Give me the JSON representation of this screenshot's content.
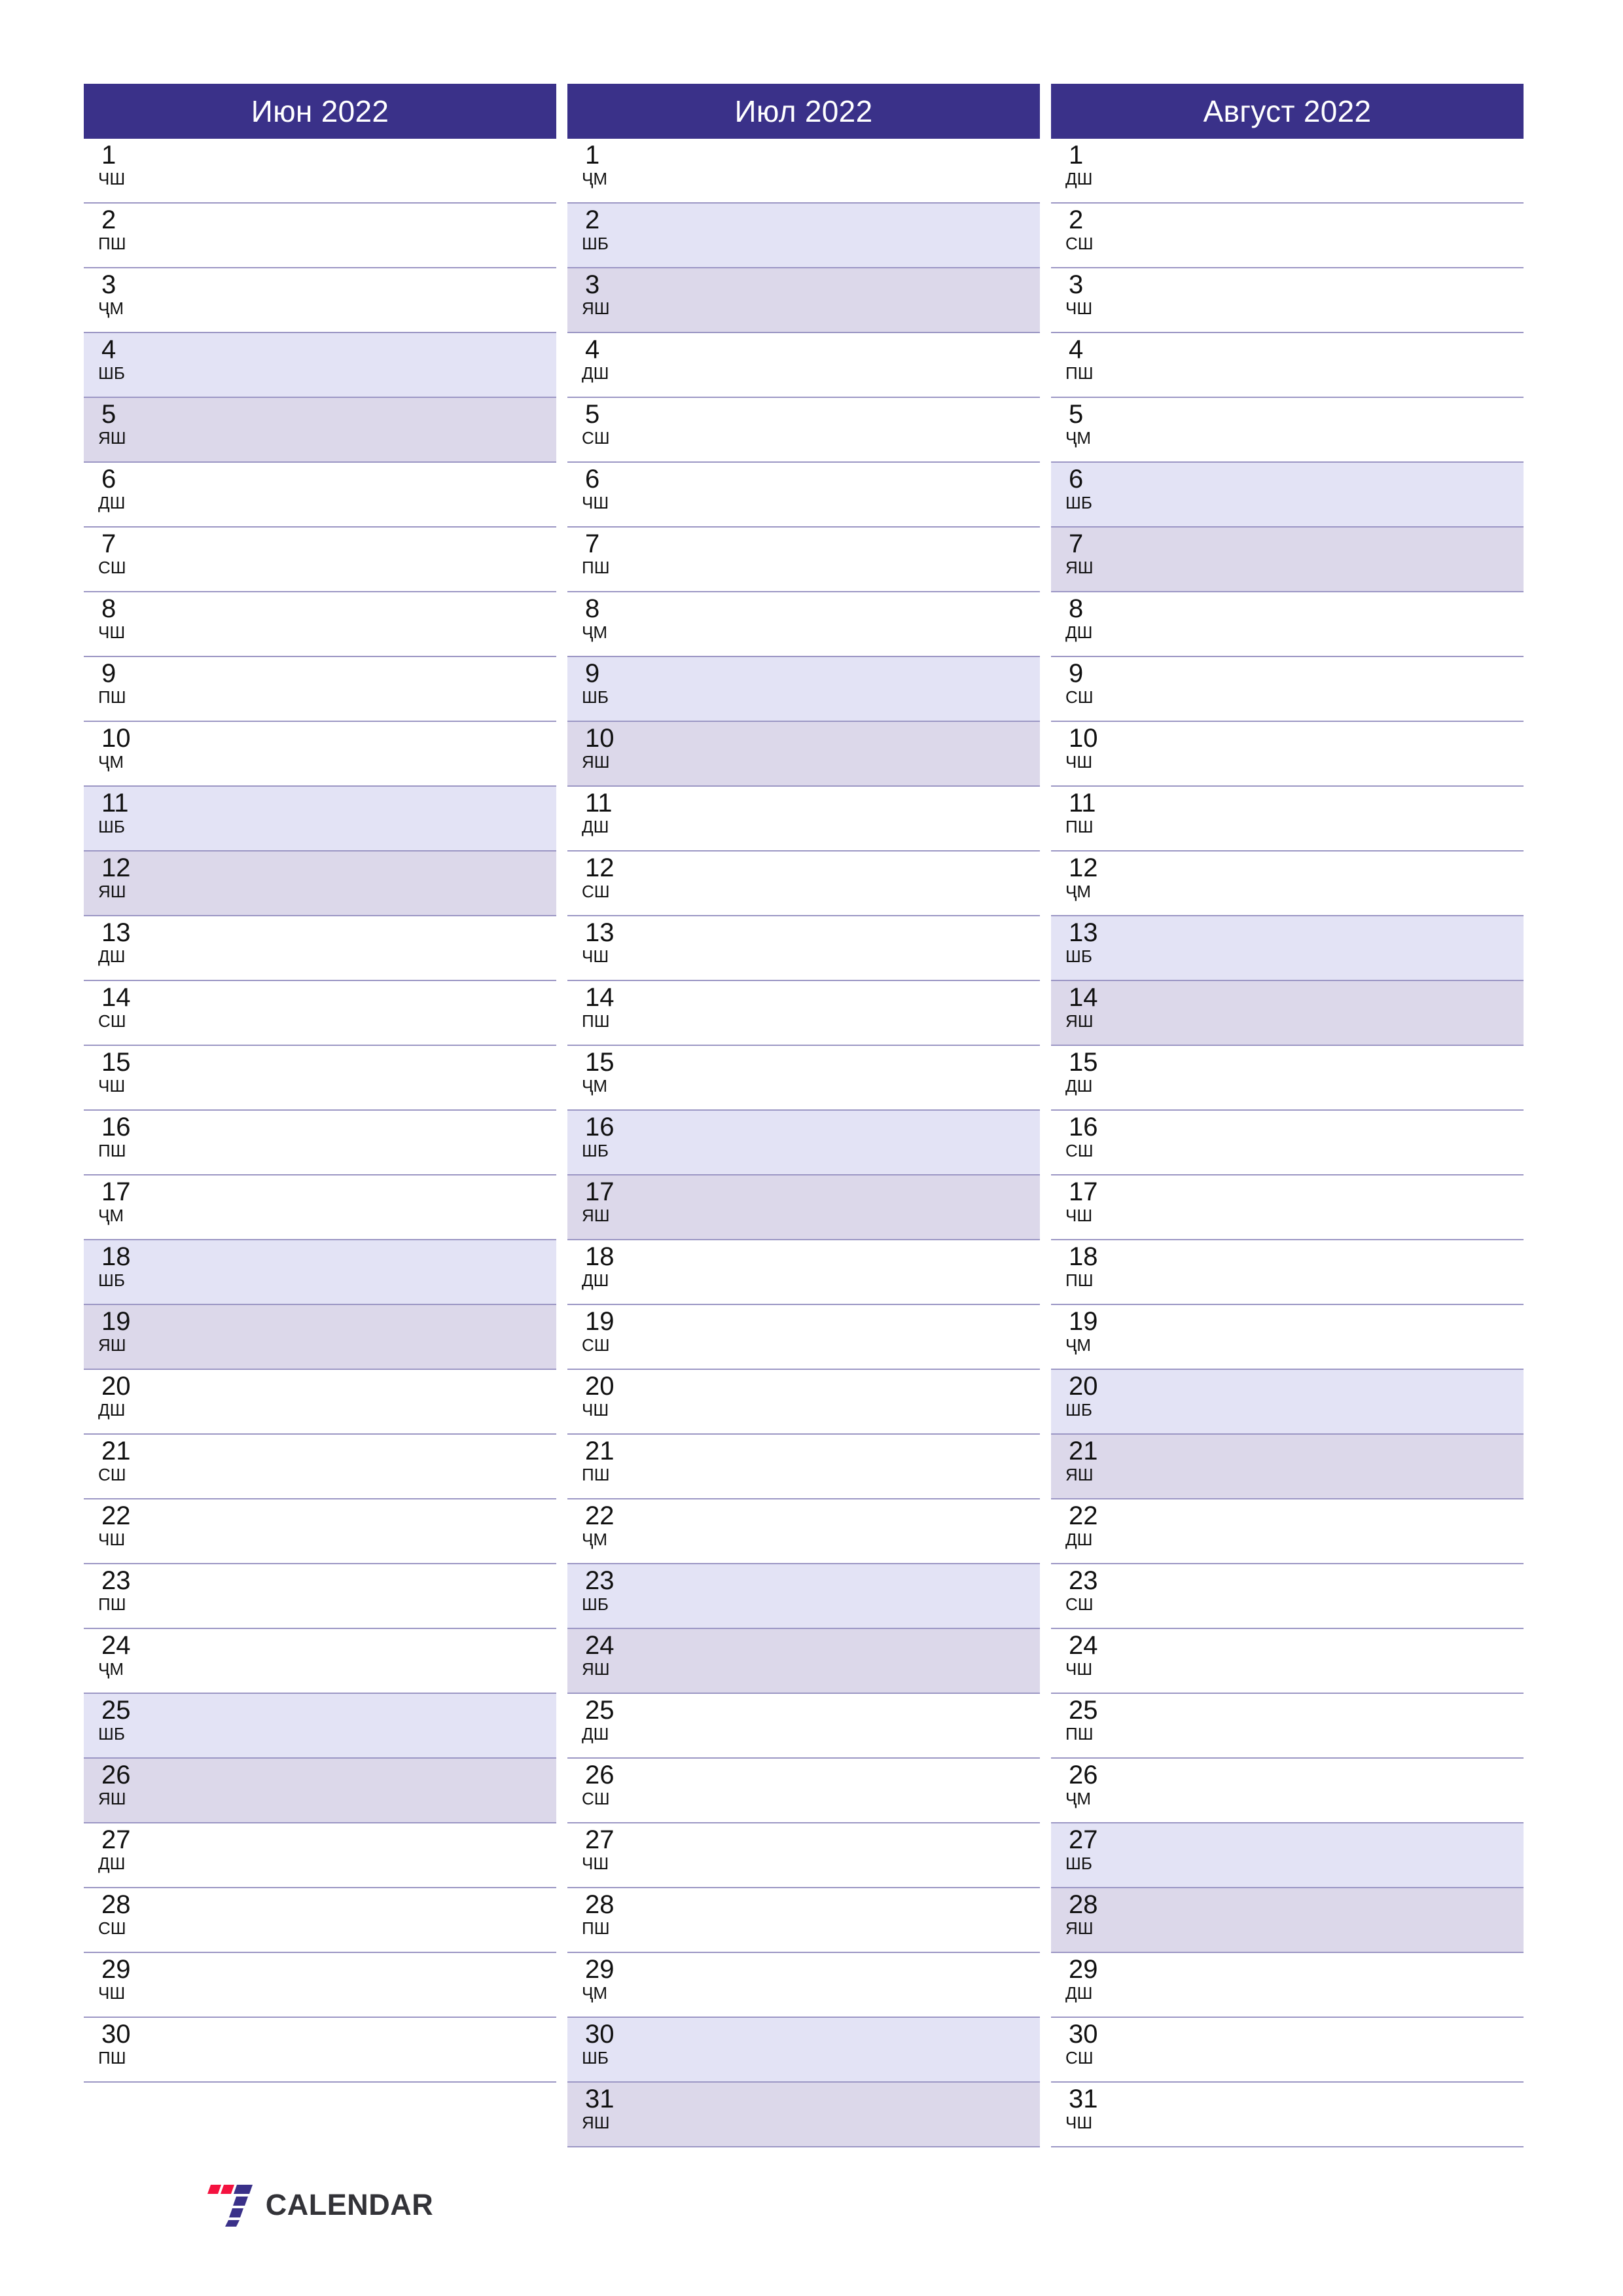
{
  "document": {
    "type": "printable-calendar-planner",
    "year": "2022",
    "logo": {
      "text": "CALENDAR",
      "mark": "seven-stripes-logo-icon",
      "colors": {
        "red": "#f4123f",
        "blue": "#3a3189",
        "text": "#333338"
      }
    }
  },
  "theme": {
    "header_bg": "#3a3189",
    "header_text": "#ffffff",
    "saturday_bg": "#e3e3f5",
    "sunday_bg": "#dcd8ea",
    "rule": "#9b96c4",
    "day_text": "#111111",
    "page_bg": "#ffffff"
  },
  "weekday_abbr": {
    "mon": "ДШ",
    "tue": "СШ",
    "wed": "ЧШ",
    "thu": "ПШ",
    "fri": "ҶМ",
    "sat": "ШБ",
    "sun": "ЯШ"
  },
  "months": [
    {
      "title": "Июн 2022",
      "name": "Июн",
      "year": "2022",
      "days": [
        {
          "num": "1",
          "wd": "ЧШ",
          "kind": "weekday"
        },
        {
          "num": "2",
          "wd": "ПШ",
          "kind": "weekday"
        },
        {
          "num": "3",
          "wd": "ҶМ",
          "kind": "weekday"
        },
        {
          "num": "4",
          "wd": "ШБ",
          "kind": "sat"
        },
        {
          "num": "5",
          "wd": "ЯШ",
          "kind": "sun"
        },
        {
          "num": "6",
          "wd": "ДШ",
          "kind": "weekday"
        },
        {
          "num": "7",
          "wd": "СШ",
          "kind": "weekday"
        },
        {
          "num": "8",
          "wd": "ЧШ",
          "kind": "weekday"
        },
        {
          "num": "9",
          "wd": "ПШ",
          "kind": "weekday"
        },
        {
          "num": "10",
          "wd": "ҶМ",
          "kind": "weekday"
        },
        {
          "num": "11",
          "wd": "ШБ",
          "kind": "sat"
        },
        {
          "num": "12",
          "wd": "ЯШ",
          "kind": "sun"
        },
        {
          "num": "13",
          "wd": "ДШ",
          "kind": "weekday"
        },
        {
          "num": "14",
          "wd": "СШ",
          "kind": "weekday"
        },
        {
          "num": "15",
          "wd": "ЧШ",
          "kind": "weekday"
        },
        {
          "num": "16",
          "wd": "ПШ",
          "kind": "weekday"
        },
        {
          "num": "17",
          "wd": "ҶМ",
          "kind": "weekday"
        },
        {
          "num": "18",
          "wd": "ШБ",
          "kind": "sat"
        },
        {
          "num": "19",
          "wd": "ЯШ",
          "kind": "sun"
        },
        {
          "num": "20",
          "wd": "ДШ",
          "kind": "weekday"
        },
        {
          "num": "21",
          "wd": "СШ",
          "kind": "weekday"
        },
        {
          "num": "22",
          "wd": "ЧШ",
          "kind": "weekday"
        },
        {
          "num": "23",
          "wd": "ПШ",
          "kind": "weekday"
        },
        {
          "num": "24",
          "wd": "ҶМ",
          "kind": "weekday"
        },
        {
          "num": "25",
          "wd": "ШБ",
          "kind": "sat"
        },
        {
          "num": "26",
          "wd": "ЯШ",
          "kind": "sun"
        },
        {
          "num": "27",
          "wd": "ДШ",
          "kind": "weekday"
        },
        {
          "num": "28",
          "wd": "СШ",
          "kind": "weekday"
        },
        {
          "num": "29",
          "wd": "ЧШ",
          "kind": "weekday"
        },
        {
          "num": "30",
          "wd": "ПШ",
          "kind": "weekday"
        }
      ]
    },
    {
      "title": "Июл 2022",
      "name": "Июл",
      "year": "2022",
      "days": [
        {
          "num": "1",
          "wd": "ҶМ",
          "kind": "weekday"
        },
        {
          "num": "2",
          "wd": "ШБ",
          "kind": "sat"
        },
        {
          "num": "3",
          "wd": "ЯШ",
          "kind": "sun"
        },
        {
          "num": "4",
          "wd": "ДШ",
          "kind": "weekday"
        },
        {
          "num": "5",
          "wd": "СШ",
          "kind": "weekday"
        },
        {
          "num": "6",
          "wd": "ЧШ",
          "kind": "weekday"
        },
        {
          "num": "7",
          "wd": "ПШ",
          "kind": "weekday"
        },
        {
          "num": "8",
          "wd": "ҶМ",
          "kind": "weekday"
        },
        {
          "num": "9",
          "wd": "ШБ",
          "kind": "sat"
        },
        {
          "num": "10",
          "wd": "ЯШ",
          "kind": "sun"
        },
        {
          "num": "11",
          "wd": "ДШ",
          "kind": "weekday"
        },
        {
          "num": "12",
          "wd": "СШ",
          "kind": "weekday"
        },
        {
          "num": "13",
          "wd": "ЧШ",
          "kind": "weekday"
        },
        {
          "num": "14",
          "wd": "ПШ",
          "kind": "weekday"
        },
        {
          "num": "15",
          "wd": "ҶМ",
          "kind": "weekday"
        },
        {
          "num": "16",
          "wd": "ШБ",
          "kind": "sat"
        },
        {
          "num": "17",
          "wd": "ЯШ",
          "kind": "sun"
        },
        {
          "num": "18",
          "wd": "ДШ",
          "kind": "weekday"
        },
        {
          "num": "19",
          "wd": "СШ",
          "kind": "weekday"
        },
        {
          "num": "20",
          "wd": "ЧШ",
          "kind": "weekday"
        },
        {
          "num": "21",
          "wd": "ПШ",
          "kind": "weekday"
        },
        {
          "num": "22",
          "wd": "ҶМ",
          "kind": "weekday"
        },
        {
          "num": "23",
          "wd": "ШБ",
          "kind": "sat"
        },
        {
          "num": "24",
          "wd": "ЯШ",
          "kind": "sun"
        },
        {
          "num": "25",
          "wd": "ДШ",
          "kind": "weekday"
        },
        {
          "num": "26",
          "wd": "СШ",
          "kind": "weekday"
        },
        {
          "num": "27",
          "wd": "ЧШ",
          "kind": "weekday"
        },
        {
          "num": "28",
          "wd": "ПШ",
          "kind": "weekday"
        },
        {
          "num": "29",
          "wd": "ҶМ",
          "kind": "weekday"
        },
        {
          "num": "30",
          "wd": "ШБ",
          "kind": "sat"
        },
        {
          "num": "31",
          "wd": "ЯШ",
          "kind": "sun"
        }
      ]
    },
    {
      "title": "Август 2022",
      "name": "Август",
      "year": "2022",
      "days": [
        {
          "num": "1",
          "wd": "ДШ",
          "kind": "weekday"
        },
        {
          "num": "2",
          "wd": "СШ",
          "kind": "weekday"
        },
        {
          "num": "3",
          "wd": "ЧШ",
          "kind": "weekday"
        },
        {
          "num": "4",
          "wd": "ПШ",
          "kind": "weekday"
        },
        {
          "num": "5",
          "wd": "ҶМ",
          "kind": "weekday"
        },
        {
          "num": "6",
          "wd": "ШБ",
          "kind": "sat"
        },
        {
          "num": "7",
          "wd": "ЯШ",
          "kind": "sun"
        },
        {
          "num": "8",
          "wd": "ДШ",
          "kind": "weekday"
        },
        {
          "num": "9",
          "wd": "СШ",
          "kind": "weekday"
        },
        {
          "num": "10",
          "wd": "ЧШ",
          "kind": "weekday"
        },
        {
          "num": "11",
          "wd": "ПШ",
          "kind": "weekday"
        },
        {
          "num": "12",
          "wd": "ҶМ",
          "kind": "weekday"
        },
        {
          "num": "13",
          "wd": "ШБ",
          "kind": "sat"
        },
        {
          "num": "14",
          "wd": "ЯШ",
          "kind": "sun"
        },
        {
          "num": "15",
          "wd": "ДШ",
          "kind": "weekday"
        },
        {
          "num": "16",
          "wd": "СШ",
          "kind": "weekday"
        },
        {
          "num": "17",
          "wd": "ЧШ",
          "kind": "weekday"
        },
        {
          "num": "18",
          "wd": "ПШ",
          "kind": "weekday"
        },
        {
          "num": "19",
          "wd": "ҶМ",
          "kind": "weekday"
        },
        {
          "num": "20",
          "wd": "ШБ",
          "kind": "sat"
        },
        {
          "num": "21",
          "wd": "ЯШ",
          "kind": "sun"
        },
        {
          "num": "22",
          "wd": "ДШ",
          "kind": "weekday"
        },
        {
          "num": "23",
          "wd": "СШ",
          "kind": "weekday"
        },
        {
          "num": "24",
          "wd": "ЧШ",
          "kind": "weekday"
        },
        {
          "num": "25",
          "wd": "ПШ",
          "kind": "weekday"
        },
        {
          "num": "26",
          "wd": "ҶМ",
          "kind": "weekday"
        },
        {
          "num": "27",
          "wd": "ШБ",
          "kind": "sat"
        },
        {
          "num": "28",
          "wd": "ЯШ",
          "kind": "sun"
        },
        {
          "num": "29",
          "wd": "ДШ",
          "kind": "weekday"
        },
        {
          "num": "30",
          "wd": "СШ",
          "kind": "weekday"
        },
        {
          "num": "31",
          "wd": "ЧШ",
          "kind": "weekday"
        }
      ]
    }
  ]
}
